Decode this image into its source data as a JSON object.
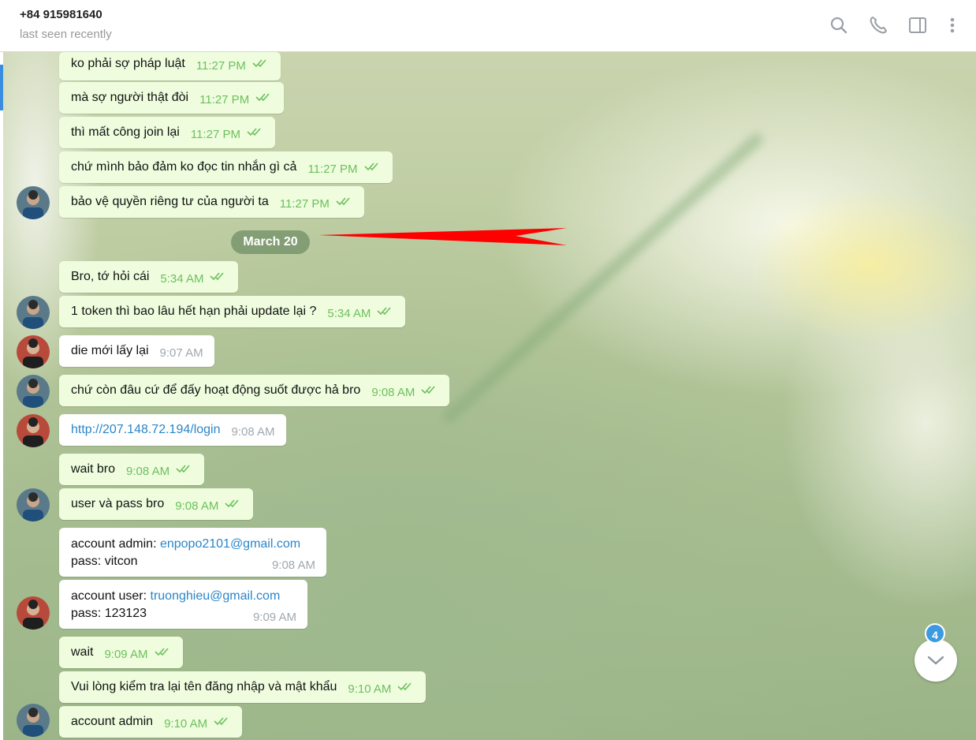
{
  "header": {
    "contact_name": "+84 915981640",
    "status": "last seen recently"
  },
  "date_separator": "March 20",
  "messages": [
    {
      "text": "ko phải sợ pháp luật",
      "time": "11:27 PM"
    },
    {
      "text": "mà sợ người thật đòi",
      "time": "11:27 PM"
    },
    {
      "text": "thì mất công join lại",
      "time": "11:27 PM"
    },
    {
      "text": "chứ mình bảo đảm ko đọc tin nhắn gì cả",
      "time": "11:27 PM"
    },
    {
      "text": "bảo vệ quyền riêng tư của người ta",
      "time": "11:27 PM"
    },
    {
      "text": "Bro, tớ hỏi cái",
      "time": "5:34 AM"
    },
    {
      "text": "1 token thì bao lâu hết hạn phải update lại ?",
      "time": "5:34 AM"
    },
    {
      "text": "die mới lấy lại",
      "time": "9:07 AM"
    },
    {
      "text": "chứ còn đâu cứ để đấy hoạt động suốt được hả bro",
      "time": "9:08 AM"
    },
    {
      "text": "http://207.148.72.194/login",
      "time": "9:08 AM"
    },
    {
      "text": "wait bro",
      "time": "9:08 AM"
    },
    {
      "text": "user và pass bro",
      "time": "9:08 AM"
    },
    {
      "label": "account admin: ",
      "email": "enpopo2101@gmail.com",
      "pass": "pass: vitcon",
      "time": "9:08 AM"
    },
    {
      "label": "account user: ",
      "email": "truonghieu@gmail.com",
      "pass": "pass: 123123",
      "time": "9:09 AM"
    },
    {
      "text": "wait",
      "time": "9:09 AM"
    },
    {
      "text": "Vui lòng kiểm tra lại tên đăng nhập và mật khẩu",
      "time": "9:10 AM"
    },
    {
      "text": "account admin",
      "time": "9:10 AM"
    }
  ],
  "unread_count": "4",
  "icons": {
    "search": "search-icon",
    "call": "phone-icon",
    "sidebar": "sidebar-toggle-icon",
    "more": "more-vertical-icon",
    "scroll": "chevron-down-icon"
  },
  "colors": {
    "outgoing_bubble": "#effdde",
    "incoming_bubble": "#ffffff",
    "outgoing_time": "#6cbf5d",
    "link": "#2a86c9",
    "annotation_arrow": "#ff0000"
  }
}
